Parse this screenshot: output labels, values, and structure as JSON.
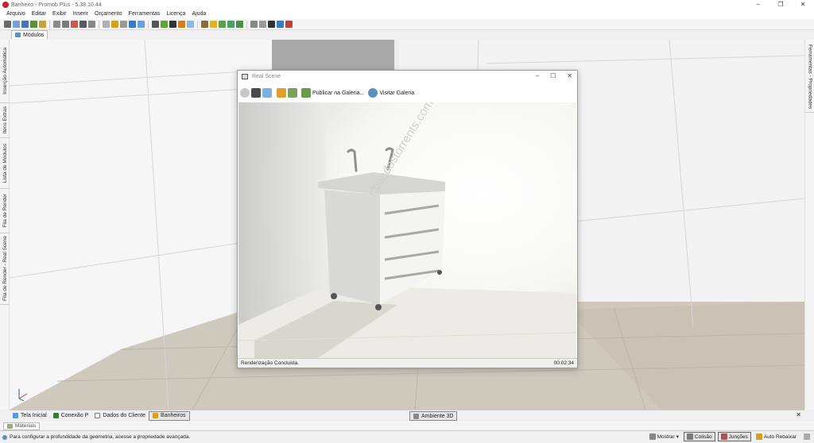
{
  "window": {
    "title": "Banheiro - Promob Plus - 5.38.10.44",
    "controls": [
      "–",
      "❐",
      "✕"
    ]
  },
  "menu": [
    "Arquivo",
    "Editar",
    "Exibir",
    "Inserir",
    "Orçamento",
    "Ferramentas",
    "Licença",
    "Ajuda"
  ],
  "toolbar": {
    "button_colors": [
      "#6a6a6a",
      "#7aa0d0",
      "#4a74b8",
      "#5c8f3e",
      "#c9a13a",
      "#8a8a8a",
      "#7b7b7b",
      "#cc5555",
      "#5a5a5a",
      "#888",
      "#b0b0b0",
      "#d4a020",
      "#999",
      "#3a7ac0",
      "#68a0e0",
      "#555",
      "#5fa33a",
      "#333",
      "#d08020",
      "#8bb7e0",
      "#8a6a3a",
      "#e0b030",
      "#5c9e4a",
      "#49a060",
      "#4a8f4a",
      "#888",
      "#999",
      "#333",
      "#3a7ac0",
      "#c04040"
    ]
  },
  "modules_tab": {
    "label": "Módulos"
  },
  "left_tabs": [
    "Inserção Automática",
    "Itens Extras",
    "Lista de Módulos",
    "Fila de Render",
    "Fila de Render - Real Scene"
  ],
  "right_tabs": [
    "Ferramentas - Propriedades"
  ],
  "real_scene": {
    "title": "Real Scene",
    "controls": [
      "–",
      "☐",
      "✕"
    ],
    "toolbar_icons": [
      "stop-icon",
      "save-icon",
      "copy-icon",
      "open-icon",
      "image-icon"
    ],
    "publish_label": "Publicar na Galeria...",
    "visit_label": "Visitar Galeria",
    "watermark": "rfbacdostorrents.com",
    "status": "Renderização Concluída.",
    "time": "00:02:34"
  },
  "bottom_tabs": [
    {
      "label": "Tela Inicial",
      "color": "#5a9ad6"
    },
    {
      "label": "Conexão P",
      "color": "#3a7a3a"
    },
    {
      "label": "Dados do Cliente",
      "color": "#ffffff"
    },
    {
      "label": "Banheiros",
      "color": "#d4a020"
    }
  ],
  "ambiente_tab": {
    "label": "Ambiente 3D"
  },
  "close_symbol": "✕",
  "materials_tab": {
    "label": "Materiais"
  },
  "status": {
    "message": "Para configurar a profundidade da geometria, acesse a propriedade avançada.",
    "mostrar": "Mostrar",
    "colisao": "Colisão",
    "juncoes": "Junções",
    "auto_rebaixar": "Auto Rebaixar"
  },
  "colors": {
    "brand": "#c8202a",
    "floor": "#cfc9bd",
    "wall": "#f3f3f3"
  }
}
